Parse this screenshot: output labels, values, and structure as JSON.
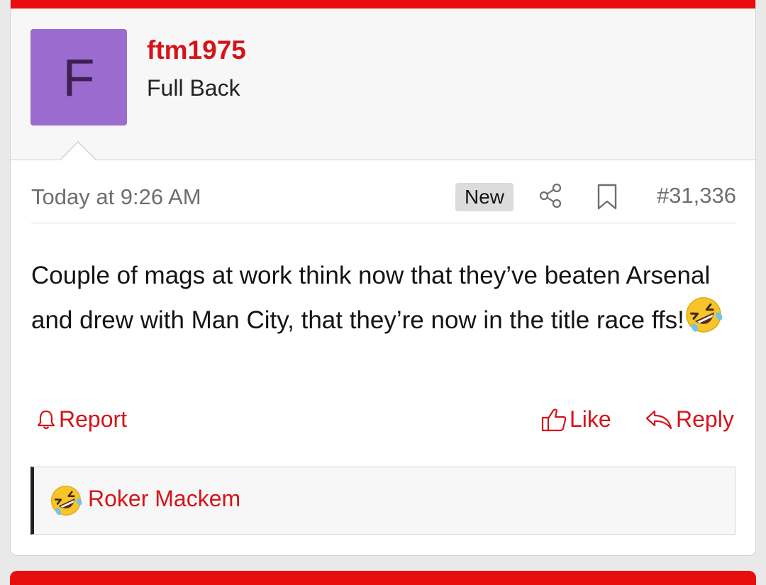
{
  "post": {
    "user": {
      "avatar_letter": "F",
      "username": "ftm1975",
      "title": "Full Back"
    },
    "timestamp": "Today at 9:26 AM",
    "badge": "New",
    "post_number": "#31,336",
    "body_text": "Couple of mags at work think now that they’ve beaten Arsenal and drew with Man City, that they’re now in the title race ffs!",
    "body_emoji": "rolling-on-floor-laughing-emoji",
    "actions": {
      "report_label": "Report",
      "like_label": "Like",
      "reply_label": "Reply"
    },
    "reactions": {
      "emoji": "rolling-on-floor-laughing-emoji",
      "users": "Roker Mackem"
    }
  },
  "colors": {
    "accent": "#d4141a",
    "top_bar": "#e80e0e",
    "avatar_bg": "#9b6bcf",
    "avatar_letter": "#3d2152"
  },
  "icons": [
    "share-icon",
    "bookmark-icon",
    "bell-icon",
    "thumbs-up-icon",
    "reply-arrow-icon"
  ]
}
